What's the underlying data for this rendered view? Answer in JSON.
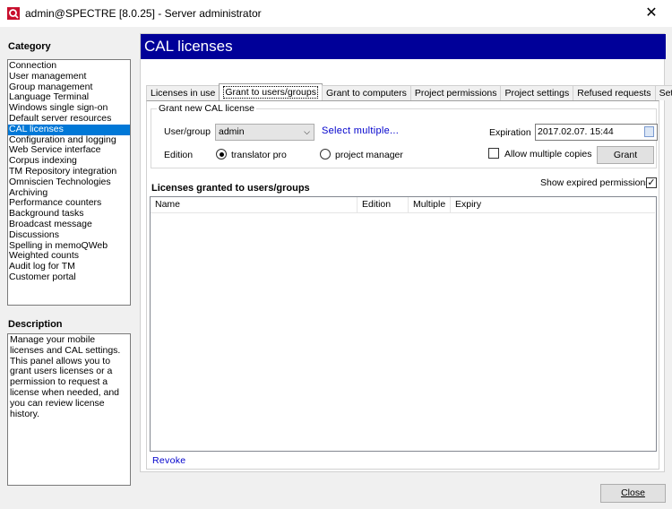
{
  "window": {
    "title": "admin@SPECTRE [8.0.25] - Server administrator",
    "close_glyph": "✕",
    "app_icon": "memoq-icon"
  },
  "left": {
    "category_label": "Category",
    "categories": [
      "Connection",
      "User management",
      "Group management",
      "Language Terminal",
      "Windows single sign-on",
      "Default server resources",
      "CAL licenses",
      "Configuration and logging",
      "Web Service interface",
      "Corpus indexing",
      "TM Repository integration",
      "Omniscien Technologies",
      "Archiving",
      "Performance counters",
      "Background tasks",
      "Broadcast message",
      "Discussions",
      "Spelling in memoQWeb",
      "Weighted counts",
      "Audit log for TM",
      "Customer portal"
    ],
    "selected_category": "CAL licenses",
    "description_label": "Description",
    "description_text": "Manage your mobile licenses and CAL settings. This panel allows you to grant users licenses or a permission to request a license when needed, and you can review license history."
  },
  "panel": {
    "title": "CAL licenses",
    "tabs": [
      "Licenses in use",
      "Grant to users/groups",
      "Grant to computers",
      "Project permissions",
      "Project settings",
      "Refused requests",
      "Settings"
    ],
    "active_tab": "Grant to users/groups",
    "grant": {
      "legend": "Grant new CAL license",
      "user_group_label": "User/group",
      "user_group_value": "admin",
      "select_multiple_link": "Select multiple...",
      "expiration_label": "Expiration",
      "expiration_value": "2017.02.07. 15:44",
      "edition_label": "Edition",
      "edition_options": [
        "translator pro",
        "project manager"
      ],
      "edition_selected": "translator pro",
      "allow_multiple_label": "Allow multiple copies",
      "allow_multiple_checked": false,
      "grant_button": "Grant"
    },
    "granted": {
      "title": "Licenses granted to users/groups",
      "show_expired_label": "Show expired permissions",
      "show_expired_checked": true,
      "columns": [
        "Name",
        "Edition",
        "Multiple",
        "Expiry"
      ],
      "rows": [],
      "revoke_link": "Revoke"
    }
  },
  "footer": {
    "close_button": "Close"
  },
  "colors": {
    "header_bg": "#000099",
    "selection": "#0078d7",
    "link": "#0000cc"
  }
}
